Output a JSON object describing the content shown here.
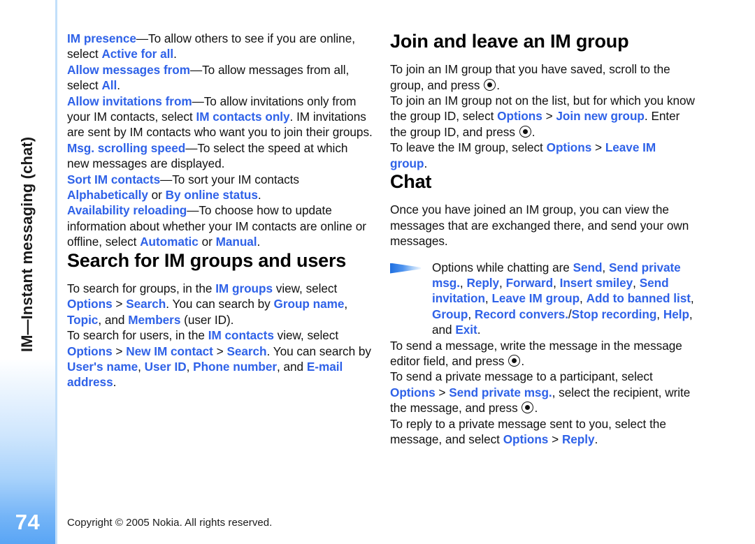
{
  "page": {
    "number": "74",
    "side_title": "IM—Instant messaging (chat)",
    "copyright": "Copyright © 2005 Nokia. All rights reserved."
  },
  "icons": {
    "tip_arrow": "tip-arrow-icon",
    "select_key": "select-key-icon"
  },
  "colors": {
    "link_blue": "#2f62e8",
    "rule_blue": "#c2dffa",
    "tab_blue": "#59a5f5",
    "body_black": "#111111"
  },
  "left_column": {
    "blocks": [
      {
        "id": "im-presence",
        "runs": [
          {
            "t": "IM presence",
            "c": "blue"
          },
          {
            "t": "—To allow others to see if you are online, select ",
            "c": "plain"
          },
          {
            "t": "Active for all",
            "c": "blue"
          },
          {
            "t": ".",
            "c": "plain"
          }
        ]
      },
      {
        "id": "allow-messages-from",
        "runs": [
          {
            "t": "Allow messages from",
            "c": "blue"
          },
          {
            "t": "—To allow messages from all, select ",
            "c": "plain"
          },
          {
            "t": "All",
            "c": "blue"
          },
          {
            "t": ".",
            "c": "plain"
          }
        ]
      },
      {
        "id": "allow-invitations-from",
        "runs": [
          {
            "t": "Allow invitations from",
            "c": "blue"
          },
          {
            "t": "—To allow invitations only from your IM contacts, select ",
            "c": "plain"
          },
          {
            "t": "IM contacts only",
            "c": "blue"
          },
          {
            "t": ". IM invitations are sent by IM contacts who want you to join their groups.",
            "c": "plain"
          }
        ]
      },
      {
        "id": "msg-scrolling-speed",
        "runs": [
          {
            "t": "Msg. scrolling speed",
            "c": "blue"
          },
          {
            "t": "—To select the speed at which new messages are displayed.",
            "c": "plain"
          }
        ]
      },
      {
        "id": "sort-im-contacts",
        "runs": [
          {
            "t": "Sort IM contacts",
            "c": "blue"
          },
          {
            "t": "—To sort your IM contacts ",
            "c": "plain"
          },
          {
            "t": "Alphabetically",
            "c": "blue"
          },
          {
            "t": " or ",
            "c": "plain"
          },
          {
            "t": "By online status",
            "c": "blue"
          },
          {
            "t": ".",
            "c": "plain"
          }
        ]
      },
      {
        "id": "availability-reloading",
        "runs": [
          {
            "t": "Availability reloading",
            "c": "blue"
          },
          {
            "t": "—To choose how to update information about whether your IM contacts are online or offline, select ",
            "c": "plain"
          },
          {
            "t": "Automatic",
            "c": "blue"
          },
          {
            "t": " or ",
            "c": "plain"
          },
          {
            "t": "Manual",
            "c": "blue"
          },
          {
            "t": ".",
            "c": "plain"
          }
        ]
      }
    ],
    "heading_search": "Search for IM groups and users",
    "search_blocks": [
      {
        "id": "search-groups",
        "runs": [
          {
            "t": "To search for groups, in the ",
            "c": "plain"
          },
          {
            "t": "IM groups",
            "c": "blue"
          },
          {
            "t": " view, select ",
            "c": "plain"
          },
          {
            "t": "Options",
            "c": "blue"
          },
          {
            "t": " > ",
            "c": "gt"
          },
          {
            "t": "Search",
            "c": "blue"
          },
          {
            "t": ". You can search by ",
            "c": "plain"
          },
          {
            "t": "Group name",
            "c": "blue"
          },
          {
            "t": ", ",
            "c": "plain"
          },
          {
            "t": "Topic",
            "c": "blue"
          },
          {
            "t": ", and ",
            "c": "plain"
          },
          {
            "t": "Members",
            "c": "blue"
          },
          {
            "t": " (user ID).",
            "c": "plain"
          }
        ]
      },
      {
        "id": "search-users",
        "runs": [
          {
            "t": "To search for users, in the ",
            "c": "plain"
          },
          {
            "t": "IM contacts",
            "c": "blue"
          },
          {
            "t": " view, select ",
            "c": "plain"
          },
          {
            "t": "Options",
            "c": "blue"
          },
          {
            "t": " > ",
            "c": "gt"
          },
          {
            "t": "New IM contact",
            "c": "blue"
          },
          {
            "t": " > ",
            "c": "gt"
          },
          {
            "t": "Search",
            "c": "blue"
          },
          {
            "t": ". You can search by ",
            "c": "plain"
          },
          {
            "t": "User's name",
            "c": "blue"
          },
          {
            "t": ", ",
            "c": "plain"
          },
          {
            "t": "User ID",
            "c": "blue"
          },
          {
            "t": ", ",
            "c": "plain"
          },
          {
            "t": "Phone number",
            "c": "blue"
          },
          {
            "t": ", and ",
            "c": "plain"
          },
          {
            "t": "E-mail address",
            "c": "blue"
          },
          {
            "t": ".",
            "c": "plain"
          }
        ]
      }
    ]
  },
  "right_column": {
    "heading_join": "Join and leave an IM group",
    "join_blocks": [
      {
        "id": "join-saved-group",
        "runs": [
          {
            "t": "To join an IM group that you have saved, scroll to the group, and press ",
            "c": "plain"
          },
          {
            "t": "",
            "c": "key"
          },
          {
            "t": ".",
            "c": "plain"
          }
        ]
      },
      {
        "id": "join-new-group",
        "runs": [
          {
            "t": "To join an IM group not on the list, but for which you know the group ID, select ",
            "c": "plain"
          },
          {
            "t": "Options",
            "c": "blue"
          },
          {
            "t": " > ",
            "c": "gt"
          },
          {
            "t": "Join new group",
            "c": "blue"
          },
          {
            "t": ". Enter the group ID, and press ",
            "c": "plain"
          },
          {
            "t": "",
            "c": "key"
          },
          {
            "t": ".",
            "c": "plain"
          }
        ]
      },
      {
        "id": "leave-group",
        "runs": [
          {
            "t": "To leave the IM group, select ",
            "c": "plain"
          },
          {
            "t": "Options",
            "c": "blue"
          },
          {
            "t": " > ",
            "c": "gt"
          },
          {
            "t": "Leave IM group",
            "c": "blue"
          },
          {
            "t": ".",
            "c": "plain"
          }
        ]
      }
    ],
    "heading_chat": "Chat",
    "chat_intro": {
      "id": "chat-intro",
      "runs": [
        {
          "t": "Once you have joined an IM group, you can view the messages that are exchanged there, and send your own messages.",
          "c": "plain"
        }
      ]
    },
    "tip": {
      "id": "chat-options-tip",
      "runs": [
        {
          "t": "Options while chatting are ",
          "c": "plain"
        },
        {
          "t": "Send",
          "c": "blue"
        },
        {
          "t": ", ",
          "c": "plain"
        },
        {
          "t": "Send private msg.",
          "c": "blue"
        },
        {
          "t": ", ",
          "c": "plain"
        },
        {
          "t": "Reply",
          "c": "blue"
        },
        {
          "t": ", ",
          "c": "plain"
        },
        {
          "t": "Forward",
          "c": "blue"
        },
        {
          "t": ", ",
          "c": "plain"
        },
        {
          "t": "Insert smiley",
          "c": "blue"
        },
        {
          "t": ", ",
          "c": "plain"
        },
        {
          "t": "Send invitation",
          "c": "blue"
        },
        {
          "t": ", ",
          "c": "plain"
        },
        {
          "t": "Leave IM group",
          "c": "blue"
        },
        {
          "t": ", ",
          "c": "plain"
        },
        {
          "t": "Add to banned list",
          "c": "blue"
        },
        {
          "t": ", ",
          "c": "plain"
        },
        {
          "t": "Group",
          "c": "blue"
        },
        {
          "t": ", ",
          "c": "plain"
        },
        {
          "t": "Record convers.",
          "c": "blue"
        },
        {
          "t": "/",
          "c": "plain"
        },
        {
          "t": "Stop recording",
          "c": "blue"
        },
        {
          "t": ", ",
          "c": "plain"
        },
        {
          "t": "Help",
          "c": "blue"
        },
        {
          "t": ", and ",
          "c": "plain"
        },
        {
          "t": "Exit",
          "c": "blue"
        },
        {
          "t": ".",
          "c": "plain"
        }
      ]
    },
    "chat_blocks": [
      {
        "id": "send-message",
        "runs": [
          {
            "t": "To send a message, write the message in the message editor field, and press ",
            "c": "plain"
          },
          {
            "t": "",
            "c": "key"
          },
          {
            "t": ".",
            "c": "plain"
          }
        ]
      },
      {
        "id": "send-private-message",
        "runs": [
          {
            "t": "To send a private message to a participant, select ",
            "c": "plain"
          },
          {
            "t": "Options",
            "c": "blue"
          },
          {
            "t": " > ",
            "c": "gt"
          },
          {
            "t": "Send private msg.",
            "c": "blue"
          },
          {
            "t": ", select the recipient, write the message, and press ",
            "c": "plain"
          },
          {
            "t": "",
            "c": "key"
          },
          {
            "t": ".",
            "c": "plain"
          }
        ]
      },
      {
        "id": "reply-private-message",
        "runs": [
          {
            "t": "To reply to a private message sent to you, select the message, and select ",
            "c": "plain"
          },
          {
            "t": "Options",
            "c": "blue"
          },
          {
            "t": " > ",
            "c": "gt"
          },
          {
            "t": "Reply",
            "c": "blue"
          },
          {
            "t": ".",
            "c": "plain"
          }
        ]
      }
    ]
  }
}
